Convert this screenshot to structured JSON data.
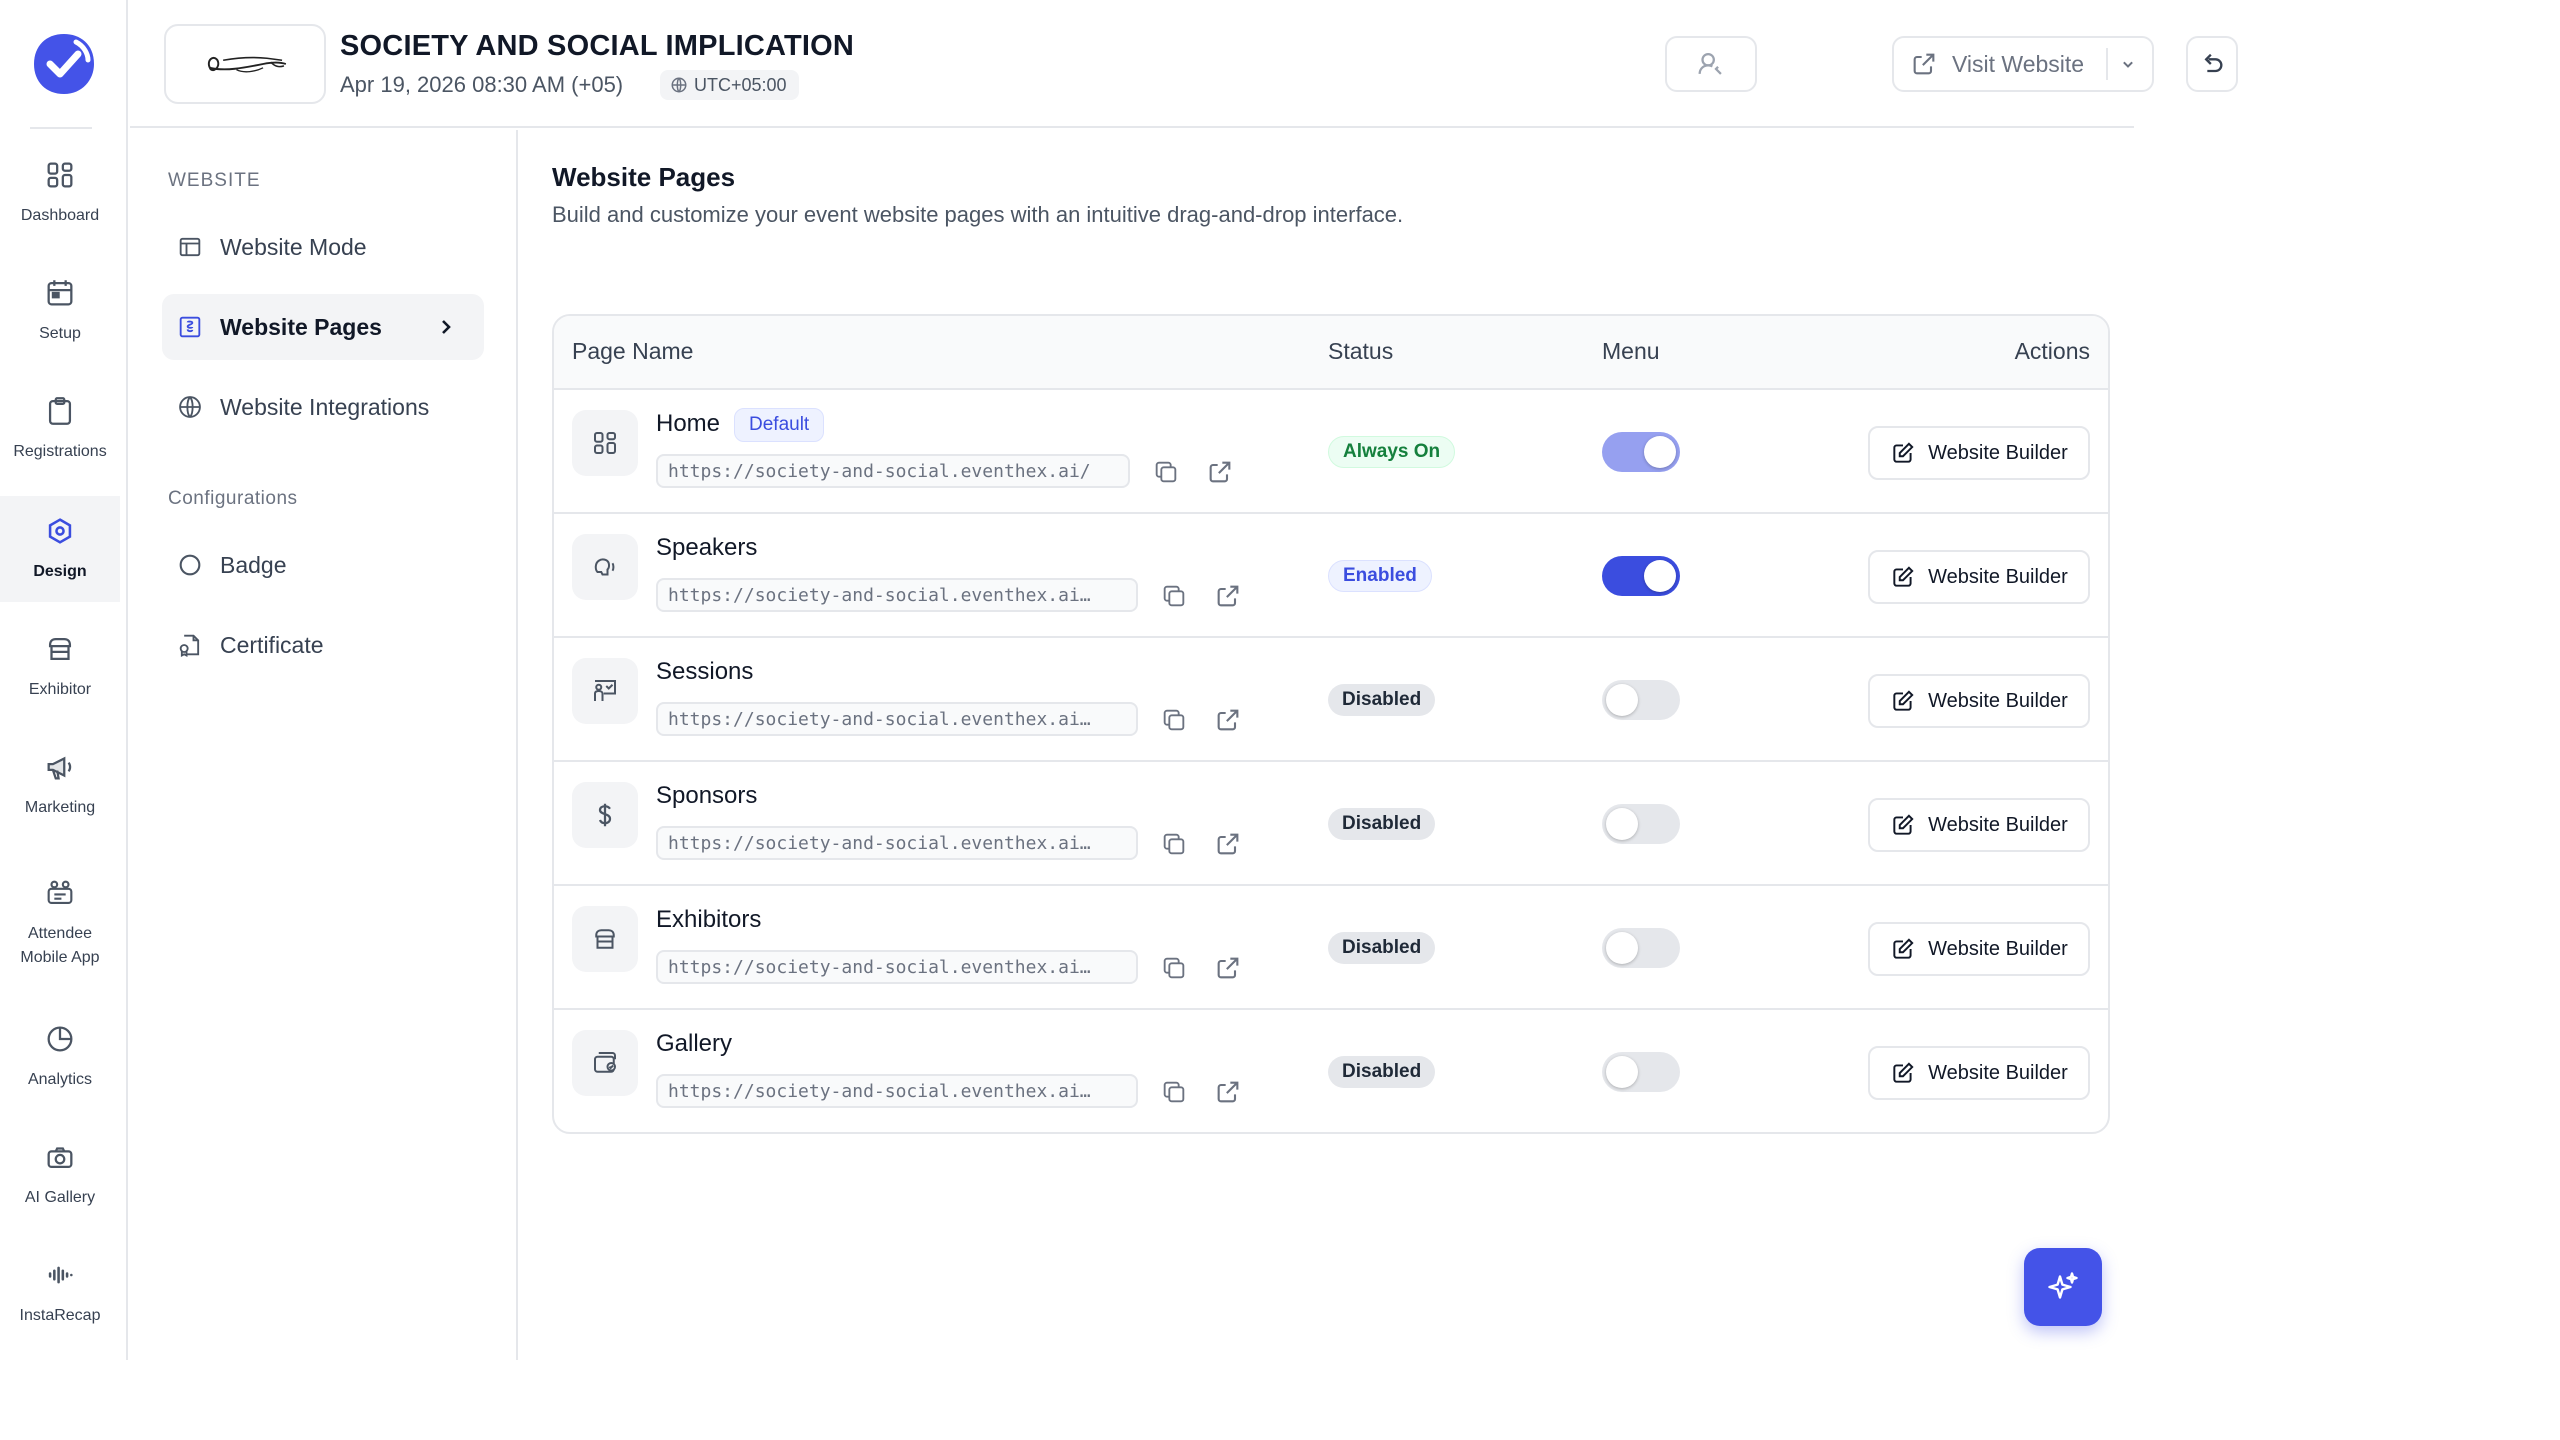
{
  "rail": {
    "items": [
      {
        "label": "Dashboard",
        "icon": "grid-icon"
      },
      {
        "label": "Setup",
        "icon": "calendar-icon"
      },
      {
        "label": "Registrations",
        "icon": "clipboard-icon"
      },
      {
        "label": "Design",
        "icon": "palette-icon"
      },
      {
        "label": "Exhibitor",
        "icon": "store-icon"
      },
      {
        "label": "Marketing",
        "icon": "megaphone-icon"
      },
      {
        "label": "Attendee\nMobile App",
        "icon": "mobile-app-icon"
      },
      {
        "label": "Analytics",
        "icon": "pie-chart-icon"
      },
      {
        "label": "AI Gallery",
        "icon": "camera-icon"
      },
      {
        "label": "InstaRecap",
        "icon": "audio-wave-icon"
      }
    ],
    "active": "Design"
  },
  "header": {
    "event_title": "SOCIETY AND SOCIAL IMPLICATION",
    "event_date": "Apr 19, 2026 08:30 AM (+05)",
    "timezone": "UTC+05:00",
    "visit_label": "Visit Website"
  },
  "subnav": {
    "section_website": "WEBSITE",
    "section_config": "Configurations",
    "website_mode": "Website Mode",
    "website_pages": "Website Pages",
    "website_integrations": "Website Integrations",
    "badge": "Badge",
    "certificate": "Certificate"
  },
  "main": {
    "title": "Website Pages",
    "subtitle": "Build and customize your event website pages with an intuitive drag-and-drop interface.",
    "columns": {
      "page_name": "Page Name",
      "status": "Status",
      "menu": "Menu",
      "actions": "Actions"
    },
    "default_badge": "Default",
    "action_label": "Website Builder",
    "rows": [
      {
        "name": "Home",
        "url": "https://society-and-social.eventhex.ai/",
        "status": "Always On",
        "menu": "locked-on",
        "icon": "grid-icon"
      },
      {
        "name": "Speakers",
        "url": "https://society-and-social.eventhex.ai…",
        "status": "Enabled",
        "menu": "on",
        "icon": "speaker-icon"
      },
      {
        "name": "Sessions",
        "url": "https://society-and-social.eventhex.ai…",
        "status": "Disabled",
        "menu": "off",
        "icon": "presentation-icon"
      },
      {
        "name": "Sponsors",
        "url": "https://society-and-social.eventhex.ai…",
        "status": "Disabled",
        "menu": "off",
        "icon": "dollar-icon"
      },
      {
        "name": "Exhibitors",
        "url": "https://society-and-social.eventhex.ai…",
        "status": "Disabled",
        "menu": "off",
        "icon": "store-icon"
      },
      {
        "name": "Gallery",
        "url": "https://society-and-social.eventhex.ai…",
        "status": "Disabled",
        "menu": "off",
        "icon": "gallery-icon"
      }
    ]
  },
  "colors": {
    "accent": "#4453e8",
    "toggle_on": "#3b4ddf",
    "toggle_locked": "#96a0f0",
    "status_on": "#15803d"
  }
}
